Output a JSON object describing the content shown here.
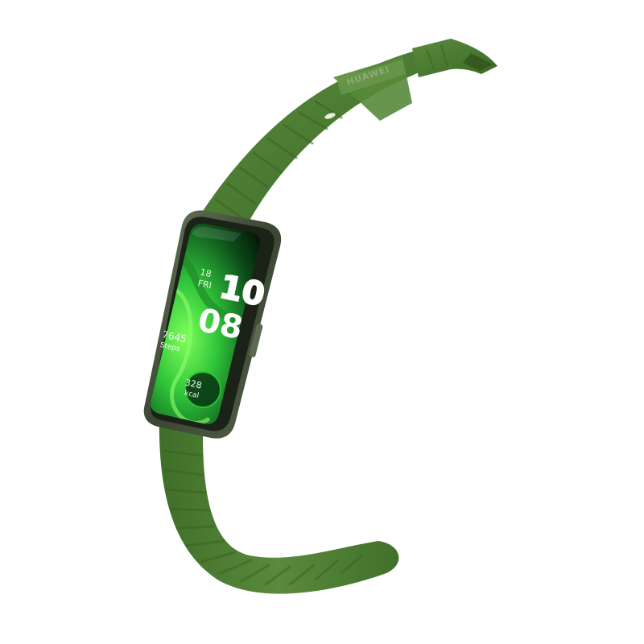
{
  "product": {
    "brand_text": "HUAWEI",
    "colors": {
      "strap": "#4a7a31",
      "strap_dark": "#2f5a1e",
      "case": "#3d4a38",
      "screen_accent": "#4ee04a"
    }
  },
  "watch_face": {
    "day": "18",
    "weekday": "FRI",
    "hour": "10",
    "minute": "08",
    "steps_value": "7645",
    "steps_label": "Steps",
    "calories_value": "328",
    "calories_label": "kcal"
  }
}
